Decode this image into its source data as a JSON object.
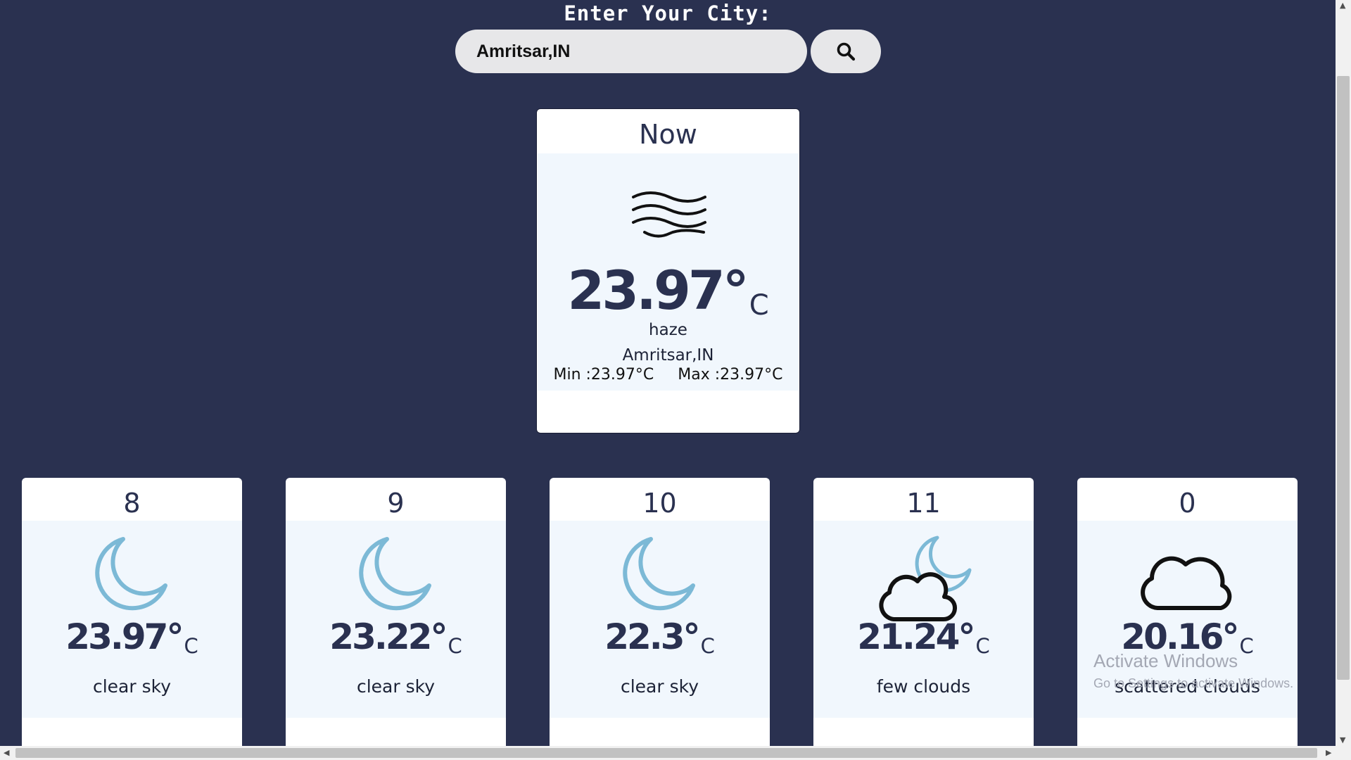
{
  "header": {
    "label": "Enter Your City:"
  },
  "search": {
    "value": "Amritsar,IN",
    "button_icon": "search-icon"
  },
  "now": {
    "title": "Now",
    "icon": "haze-icon",
    "temp": "23.97°",
    "unit": "C",
    "description": "haze",
    "city": "Amritsar,IN",
    "min": "Min :23.97°C",
    "max": "Max :23.97°C"
  },
  "forecast": [
    {
      "hour": "8",
      "icon": "moon-icon",
      "temp": "23.97°",
      "unit": "C",
      "description": "clear sky"
    },
    {
      "hour": "9",
      "icon": "moon-icon",
      "temp": "23.22°",
      "unit": "C",
      "description": "clear sky"
    },
    {
      "hour": "10",
      "icon": "moon-icon",
      "temp": "22.3°",
      "unit": "C",
      "description": "clear sky"
    },
    {
      "hour": "11",
      "icon": "cloud-moon-icon",
      "temp": "21.24°",
      "unit": "C",
      "description": "few clouds"
    },
    {
      "hour": "0",
      "icon": "cloud-icon",
      "temp": "20.16°",
      "unit": "C",
      "description": "scattered clouds"
    }
  ],
  "watermark": {
    "line1": "Activate Windows",
    "line2": "Go to Settings to activate Windows."
  },
  "colors": {
    "background": "#2a3150",
    "card": "#ffffff",
    "card_body": "#f1f7fd",
    "moon": "#7cb9d6",
    "text": "#2a3150"
  }
}
